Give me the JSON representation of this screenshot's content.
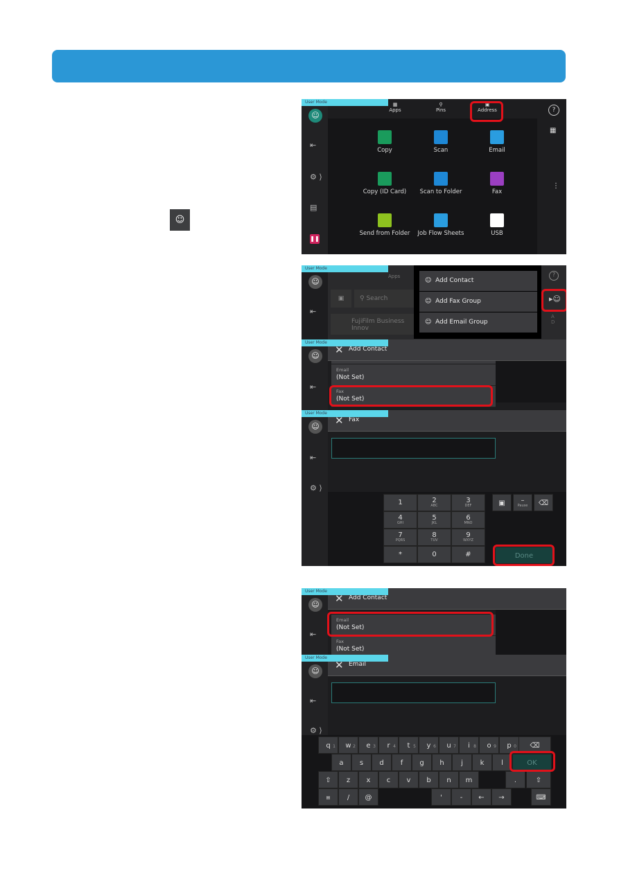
{
  "user_mode_label": "User Mode",
  "panel1": {
    "tabs": [
      {
        "label": "Apps",
        "icon": "apps-icon"
      },
      {
        "label": "Pins",
        "icon": "pin-icon"
      },
      {
        "label": "Address",
        "icon": "address-book-icon"
      }
    ],
    "apps": [
      {
        "label": "Copy",
        "color": "#1a9b5c"
      },
      {
        "label": "Scan",
        "color": "#1e88d6"
      },
      {
        "label": "Email",
        "color": "#2a9de0"
      },
      {
        "label": "Copy (ID Card)",
        "color": "#1a9b5c"
      },
      {
        "label": "Scan to Folder",
        "color": "#1e88d6"
      },
      {
        "label": "Fax",
        "color": "#9b3fc2"
      },
      {
        "label": "Send from Folder",
        "color": "#8ec21f"
      },
      {
        "label": "Job Flow Sheets",
        "color": "#2a9de0"
      },
      {
        "label": "USB",
        "color": "#ffffff"
      }
    ]
  },
  "panel2": {
    "tab_apps": "Apps",
    "search_placeholder": "Search",
    "list_item": "FujiFilm Business Innov",
    "menu": [
      "Add Contact",
      "Add Fax Group",
      "Add Email Group"
    ],
    "index": [
      "A",
      "D"
    ]
  },
  "panel3": {
    "title": "Add Contact",
    "fields": [
      {
        "label": "Email",
        "value": "(Not Set)"
      },
      {
        "label": "Fax",
        "value": "(Not Set)"
      }
    ]
  },
  "panel4": {
    "title": "Fax",
    "keys": [
      [
        "1",
        ""
      ],
      [
        "2",
        "ABC"
      ],
      [
        "3",
        "DEF"
      ],
      [
        "4",
        "GHI"
      ],
      [
        "5",
        "JKL"
      ],
      [
        "6",
        "MNO"
      ],
      [
        "7",
        "PQRS"
      ],
      [
        "8",
        "TUV"
      ],
      [
        "9",
        "WXYZ"
      ],
      [
        "*",
        ""
      ],
      [
        "0",
        ""
      ],
      [
        "#",
        ""
      ]
    ],
    "pause_label": "Pause",
    "done_label": "Done"
  },
  "panel5": {
    "title": "Add Contact",
    "fields": [
      {
        "label": "Email",
        "value": "(Not Set)"
      },
      {
        "label": "Fax",
        "value": "(Not Set)"
      }
    ]
  },
  "panel6": {
    "title": "Email",
    "row1": [
      "q",
      "w",
      "e",
      "r",
      "t",
      "y",
      "u",
      "i",
      "o",
      "p"
    ],
    "row1_digits": [
      "1",
      "2",
      "3",
      "4",
      "5",
      "6",
      "7",
      "8",
      "9",
      "0"
    ],
    "row2": [
      "a",
      "s",
      "d",
      "f",
      "g",
      "h",
      "j",
      "k",
      "l"
    ],
    "row3": [
      "z",
      "x",
      "c",
      "v",
      "b",
      "n",
      "m"
    ],
    "row4": [
      "/",
      "@"
    ],
    "row4_right": [
      "'",
      "-",
      "←",
      "→"
    ],
    "ok_label": "OK",
    "period": "."
  },
  "colors": {
    "banner": "#2b97d6",
    "highlight": "#e2111a",
    "user_mode": "#5bd6ea"
  }
}
